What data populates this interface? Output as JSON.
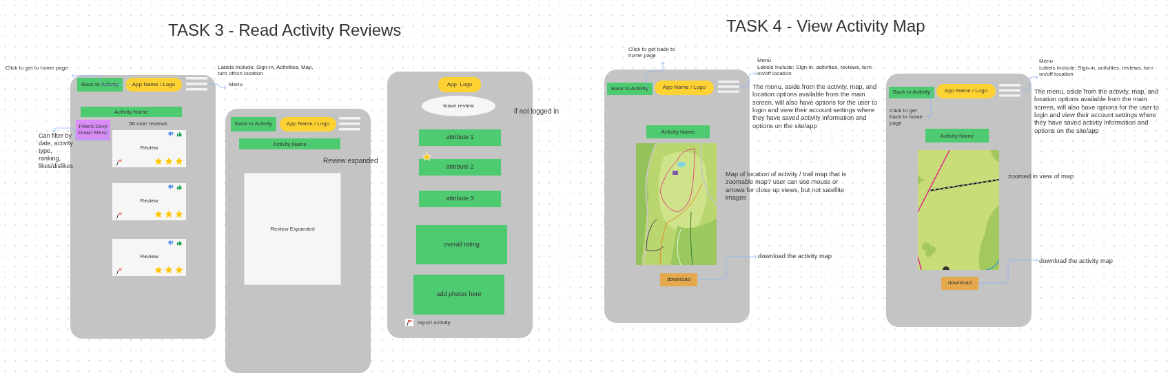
{
  "titles": [
    "TASK 3 - Read Activity Reviews",
    "TASK 4 - View Activity Map"
  ],
  "frames": [
    {
      "kind": "reviews",
      "back_button": "Back to Activity",
      "logo": "App Name / Logo",
      "activity_name": "Activity Name",
      "filter_menu": "Filters Drop Down Menu",
      "review_count": "56 user reviews",
      "reviews": [
        {
          "text": "Review",
          "stars": 3
        },
        {
          "text": "Review",
          "stars": 3
        },
        {
          "text": "Review",
          "stars": 3
        }
      ]
    },
    {
      "kind": "review_expanded",
      "back_button": "Back to Activity",
      "logo": "App Name / Logo",
      "activity_name": "Activity Name",
      "review": "Review Expanded"
    },
    {
      "kind": "leave_review",
      "logo": "App  Logo",
      "leave_review": "leave review",
      "attributes": [
        {
          "label": "attribute 1",
          "starred": false
        },
        {
          "label": "attribute 2",
          "starred": true
        },
        {
          "label": "attribute 3",
          "starred": false
        }
      ],
      "overall_rating": "overall rating",
      "add_photos": "add photos here",
      "report": "report activity"
    },
    {
      "kind": "map",
      "zoomed": false,
      "back_button": "Back to Activity",
      "logo": "App Name / Logo",
      "activity_name": "Activity Name",
      "download": "download"
    },
    {
      "kind": "map",
      "zoomed": true,
      "back_button": "Back to Activity",
      "logo": "App Name / Logo",
      "activity_name": "Activity Name",
      "download": "download"
    }
  ],
  "annotations": [
    "Click to get to home page",
    "Labels Include: Sign-in, Activities, Map, turn off/on location",
    "Menu",
    "Can filter by date, activity type, ranking, likes/dislikes",
    "Review expanded",
    "if not logged in",
    "Click to get back to home page",
    "Menu",
    "Labels Include:  Sign-in, activities, reviews, turn on/off location",
    "The menu, aside from the activity, map, and location options available from the main screen, will also have options for the user to login and view their account settings where they have saved activity information and options on the site/app",
    "Map of location of activity / trail map  that is zoomable map? user can use mouse or arrows for close up views, but not satellite images",
    "download the activity map",
    "Click to get back to home page",
    "Menu",
    "Labels Include:  Sign-in, activities, reviews, turn on/off location",
    "The menu, aside from the activity, map, and location options available from the main screen, will also have options for the user to login and view their account settings where they have saved activity information and options on the site/app",
    "zoomed in view of map",
    "download the activity map"
  ]
}
